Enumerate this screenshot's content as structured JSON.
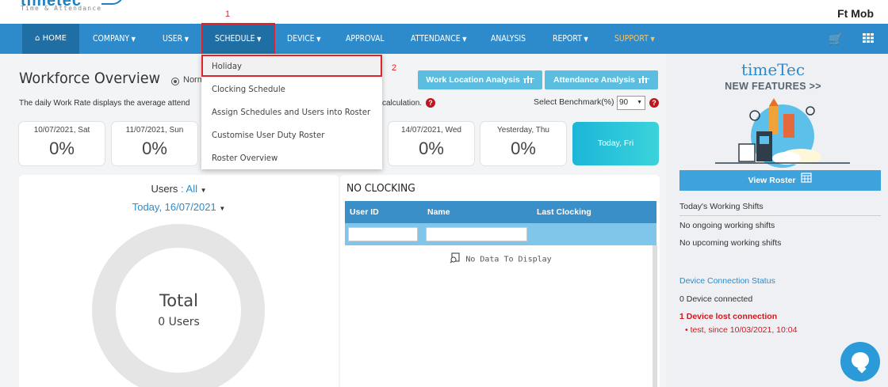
{
  "header": {
    "logo_text": "timetec",
    "logo_subtitle": "Time & Attendance",
    "user_name": "Ft Mob"
  },
  "nav": {
    "home": "HOME",
    "company": "COMPANY",
    "user": "USER",
    "schedule": "SCHEDULE",
    "device": "DEVICE",
    "approval": "APPROVAL",
    "attendance": "ATTENDANCE",
    "analysis": "ANALYSIS",
    "report": "REPORT",
    "support": "SUPPORT"
  },
  "annotations": {
    "step1": "1",
    "step2": "2"
  },
  "schedule_menu": [
    "Holiday",
    "Clocking Schedule",
    "Assign Schedules and Users into Roster",
    "Customise User Duty Roster",
    "Roster Overview"
  ],
  "overview": {
    "title": "Workforce Overview",
    "radio_label": "Norm",
    "description_start": "The daily Work Rate displays the average attend",
    "description_end": "calculation.",
    "benchmark_label": "Select Benchmark(%)",
    "benchmark_value": "90",
    "work_location_btn": "Work Location Analysis",
    "attendance_btn": "Attendance Analysis"
  },
  "day_cards": [
    {
      "label": "10/07/2021, Sat",
      "pct": "0%"
    },
    {
      "label": "11/07/2021, Sun",
      "pct": "0%"
    },
    {
      "label": "14/07/2021, Wed",
      "pct": "0%"
    },
    {
      "label": "Yesterday, Thu",
      "pct": "0%"
    }
  ],
  "today_card": "Today, Fri",
  "users_panel": {
    "users_label": "Users",
    "users_filter": "All",
    "date": "Today, 16/07/2021",
    "total_label": "Total",
    "total_users": "0 Users"
  },
  "no_clocking": {
    "title": "NO CLOCKING",
    "columns": [
      "User ID",
      "Name",
      "Last Clocking"
    ],
    "empty_text": "No Data To Display"
  },
  "sidebar": {
    "brand": "timeTec",
    "new_features": "NEW FEATURES >>",
    "view_roster": "View Roster",
    "working_shifts_title": "Today's Working Shifts",
    "no_ongoing": "No ongoing working shifts",
    "no_upcoming": "No upcoming working shifts",
    "device_status_title": "Device Connection Status",
    "device_connected": "0 Device connected",
    "device_lost": "1 Device lost connection",
    "device_lost_item": "test, since 10/03/2021, 10:04"
  },
  "colors": {
    "nav_blue": "#2d8bcb",
    "highlight_red": "#e0222a",
    "support_orange": "#f5c26b",
    "today_teal": "#1cb6d8"
  }
}
